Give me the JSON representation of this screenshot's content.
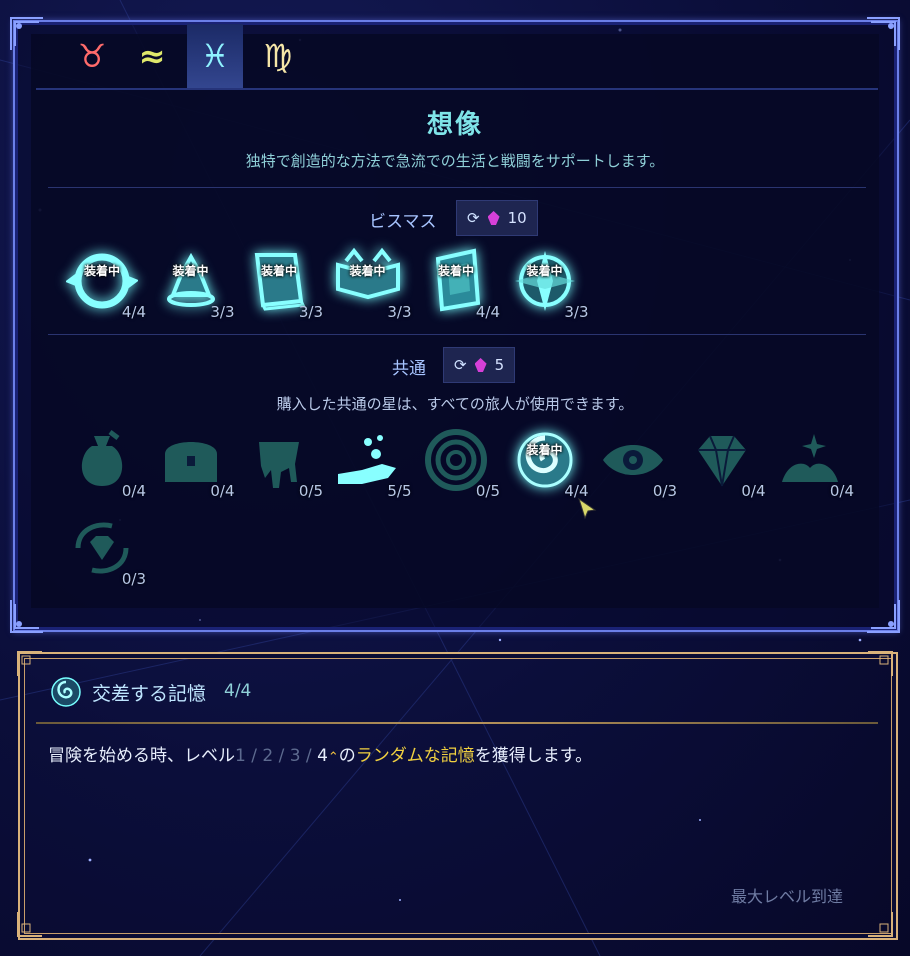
{
  "tabs": [
    {
      "symbol": "♉",
      "name": "taurus",
      "color": "#ff6b6b",
      "active": false
    },
    {
      "symbol": "≈",
      "name": "aquarius",
      "color": "#dfe86b",
      "active": false
    },
    {
      "symbol": "♓",
      "name": "pisces",
      "color": "#8ff2ff",
      "active": true
    },
    {
      "symbol": "♍",
      "name": "virgo",
      "color": "#f5e6a8",
      "active": false
    }
  ],
  "header": {
    "title": "想像",
    "subtitle": "独特で創造的な方法で急流での生活と戦闘をサポートします。"
  },
  "exclusive": {
    "label": "ビスマス",
    "reroll_cost": "10",
    "stars": [
      {
        "icon": "swirl-ring-icon",
        "equipped": "装着中",
        "level": "4/4"
      },
      {
        "icon": "bell-icon",
        "equipped": "装着中",
        "level": "3/3"
      },
      {
        "icon": "book-icon",
        "equipped": "装着中",
        "level": "3/3"
      },
      {
        "icon": "open-book-icon",
        "equipped": "装着中",
        "level": "3/3"
      },
      {
        "icon": "crystal-card-icon",
        "equipped": "装着中",
        "level": "4/4"
      },
      {
        "icon": "compass-orb-icon",
        "equipped": "装着中",
        "level": "3/3"
      }
    ]
  },
  "common": {
    "label": "共通",
    "reroll_cost": "5",
    "description": "購入した共通の星は、すべての旅人が使用できます。",
    "stars": [
      {
        "icon": "money-bag-icon",
        "equipped": "",
        "level": "0/4"
      },
      {
        "icon": "treasure-chest-icon",
        "equipped": "",
        "level": "0/4"
      },
      {
        "icon": "melting-goo-icon",
        "equipped": "",
        "level": "0/5"
      },
      {
        "icon": "hand-giving-icon",
        "equipped": "",
        "level": "5/5"
      },
      {
        "icon": "vortex-icon",
        "equipped": "",
        "level": "0/5"
      },
      {
        "icon": "spiral-orb-icon",
        "equipped": "装着中",
        "level": "4/4"
      },
      {
        "icon": "eye-icon",
        "equipped": "",
        "level": "0/3"
      },
      {
        "icon": "diamond-icon",
        "equipped": "",
        "level": "0/4"
      },
      {
        "icon": "sparkle-pile-icon",
        "equipped": "",
        "level": "0/4"
      },
      {
        "icon": "diamond-cycle-icon",
        "equipped": "",
        "level": "0/3"
      }
    ]
  },
  "detail": {
    "title": "交差する記憶",
    "level": "4/4",
    "text_prefix": "冒険を始める時、レベル",
    "levels_dim": "1 / 2 / 3 /",
    "level_current": "4",
    "text_mid": "の",
    "highlight": "ランダムな記憶",
    "text_suffix": "を獲得します。",
    "status": "最大レベル到達"
  },
  "colors": {
    "accent": "#7fe4e8",
    "frame": "#6b7fe8",
    "gold": "#d9b27a",
    "highlight": "#f0d040"
  }
}
